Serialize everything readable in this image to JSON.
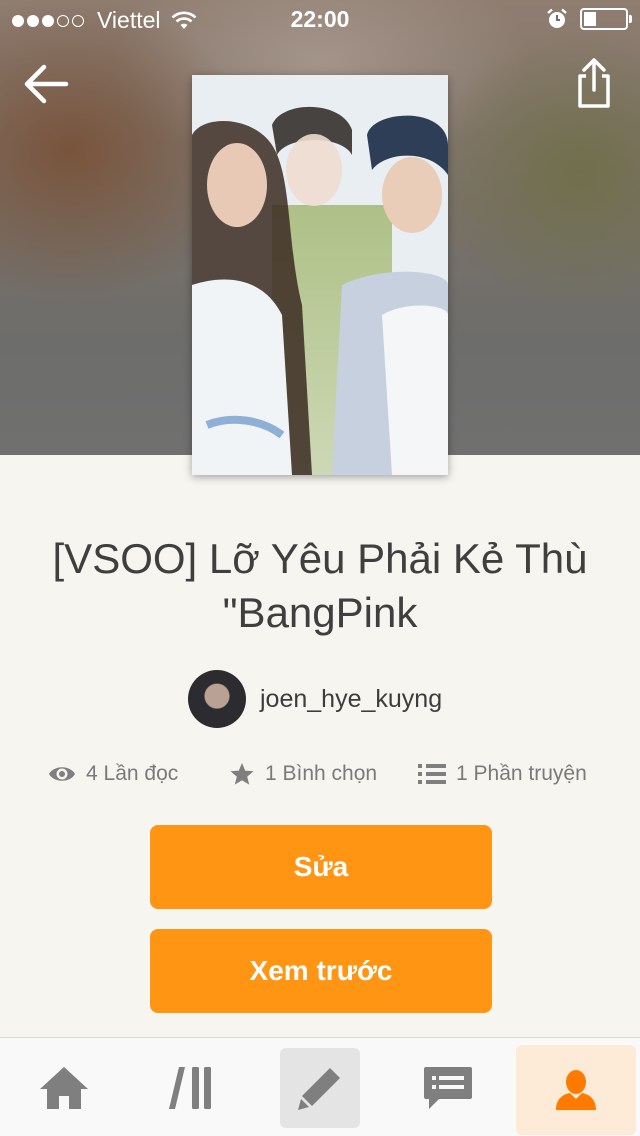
{
  "status_bar": {
    "carrier": "Viettel",
    "time": "22:00"
  },
  "story": {
    "title": "[VSOO] Lỡ Yêu Phải Kẻ Thù \"BangPink",
    "author": "joen_hye_kuyng"
  },
  "stats": {
    "reads": "4 Lần đọc",
    "votes": "1 Bình chọn",
    "parts": "1 Phần truyện"
  },
  "actions": {
    "edit_label": "Sửa",
    "preview_label": "Xem trước"
  },
  "tab_bar": {
    "items": [
      "home-icon",
      "library-icon",
      "pencil-icon",
      "messages-icon",
      "profile-icon"
    ],
    "active": "profile-icon"
  },
  "colors": {
    "accent": "#ff9513",
    "background": "#f6f5f0",
    "active_tab_bg": "#fdebd8",
    "text_dark": "#3f3f3f",
    "text_muted": "#7a7a7a",
    "icon_gray": "#7f7f7f"
  }
}
